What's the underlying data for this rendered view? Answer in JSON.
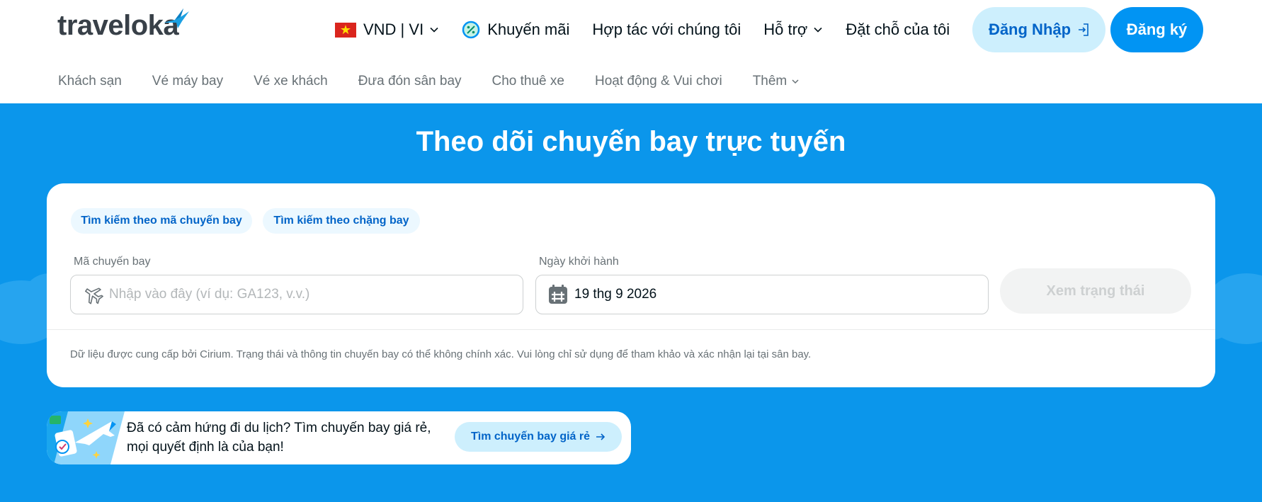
{
  "brand": {
    "name": "traveloka"
  },
  "top_nav": {
    "locale": "VND | VI",
    "promo": "Khuyến mãi",
    "partner": "Hợp tác với chúng tôi",
    "support": "Hỗ trợ",
    "bookings": "Đặt chỗ của tôi",
    "login": "Đăng Nhập",
    "register": "Đăng ký"
  },
  "sub_nav": {
    "items": [
      "Khách sạn",
      "Vé máy bay",
      "Vé xe khách",
      "Đưa đón sân bay",
      "Cho thuê xe",
      "Hoạt động & Vui chơi"
    ],
    "more": "Thêm"
  },
  "hero": {
    "title": "Theo dõi chuyến bay trực tuyến"
  },
  "search": {
    "tabs": [
      "Tìm kiếm theo mã chuyến bay",
      "Tìm kiếm theo chặng bay"
    ],
    "flight_code_label": "Mã chuyến bay",
    "flight_code_placeholder": "Nhập vào đây (ví dụ: GA123, v.v.)",
    "date_label": "Ngày khởi hành",
    "date_value": "19 thg 9 2026",
    "submit": "Xem trạng thái",
    "disclaimer": "Dữ liệu được cung cấp bởi Cirium. Trạng thái và thông tin chuyến bay có thể không chính xác. Vui lòng chỉ sử dụng để tham khảo và xác nhận lại tại sân bay."
  },
  "banner": {
    "line1": "Đã có cảm hứng đi du lịch? Tìm chuyến bay giá rẻ,",
    "line2": "mọi quyết định là của bạn!",
    "button": "Tìm chuyến bay giá rẻ"
  },
  "colors": {
    "primary": "#0194f3",
    "hero_bg": "#0b96eb",
    "light_blue": "#cdeffd",
    "text_dark": "#03121a",
    "text_muted": "#687176"
  }
}
